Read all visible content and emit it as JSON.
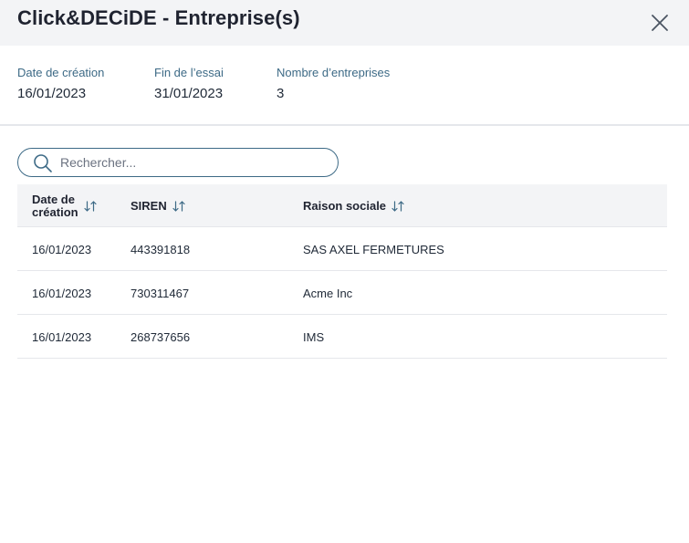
{
  "header": {
    "title": "Click&DECiDE - Entreprise(s)",
    "close_icon": "close-icon"
  },
  "meta": [
    {
      "label": "Date de création",
      "value": "16/01/2023"
    },
    {
      "label": "Fin de l’essai",
      "value": "31/01/2023"
    },
    {
      "label": "Nombre d’entreprises",
      "value": "3"
    }
  ],
  "search": {
    "placeholder": "Rechercher...",
    "value": "",
    "icon": "search-icon"
  },
  "table": {
    "columns": [
      {
        "label_line1": "Date de",
        "label_line2": "création",
        "sort_icon": "sort-icon"
      },
      {
        "label": "SIREN",
        "sort_icon": "sort-icon"
      },
      {
        "label": "Raison sociale",
        "sort_icon": "sort-icon"
      }
    ],
    "rows": [
      {
        "date": "16/01/2023",
        "siren": "443391818",
        "raison": "SAS AXEL FERMETURES"
      },
      {
        "date": "16/01/2023",
        "siren": "730311467",
        "raison": "Acme Inc"
      },
      {
        "date": "16/01/2023",
        "siren": "268737656",
        "raison": "IMS"
      }
    ]
  },
  "colors": {
    "label": "#3d6a86",
    "header_bg": "#f3f4f6",
    "border": "#e5e7eb"
  }
}
